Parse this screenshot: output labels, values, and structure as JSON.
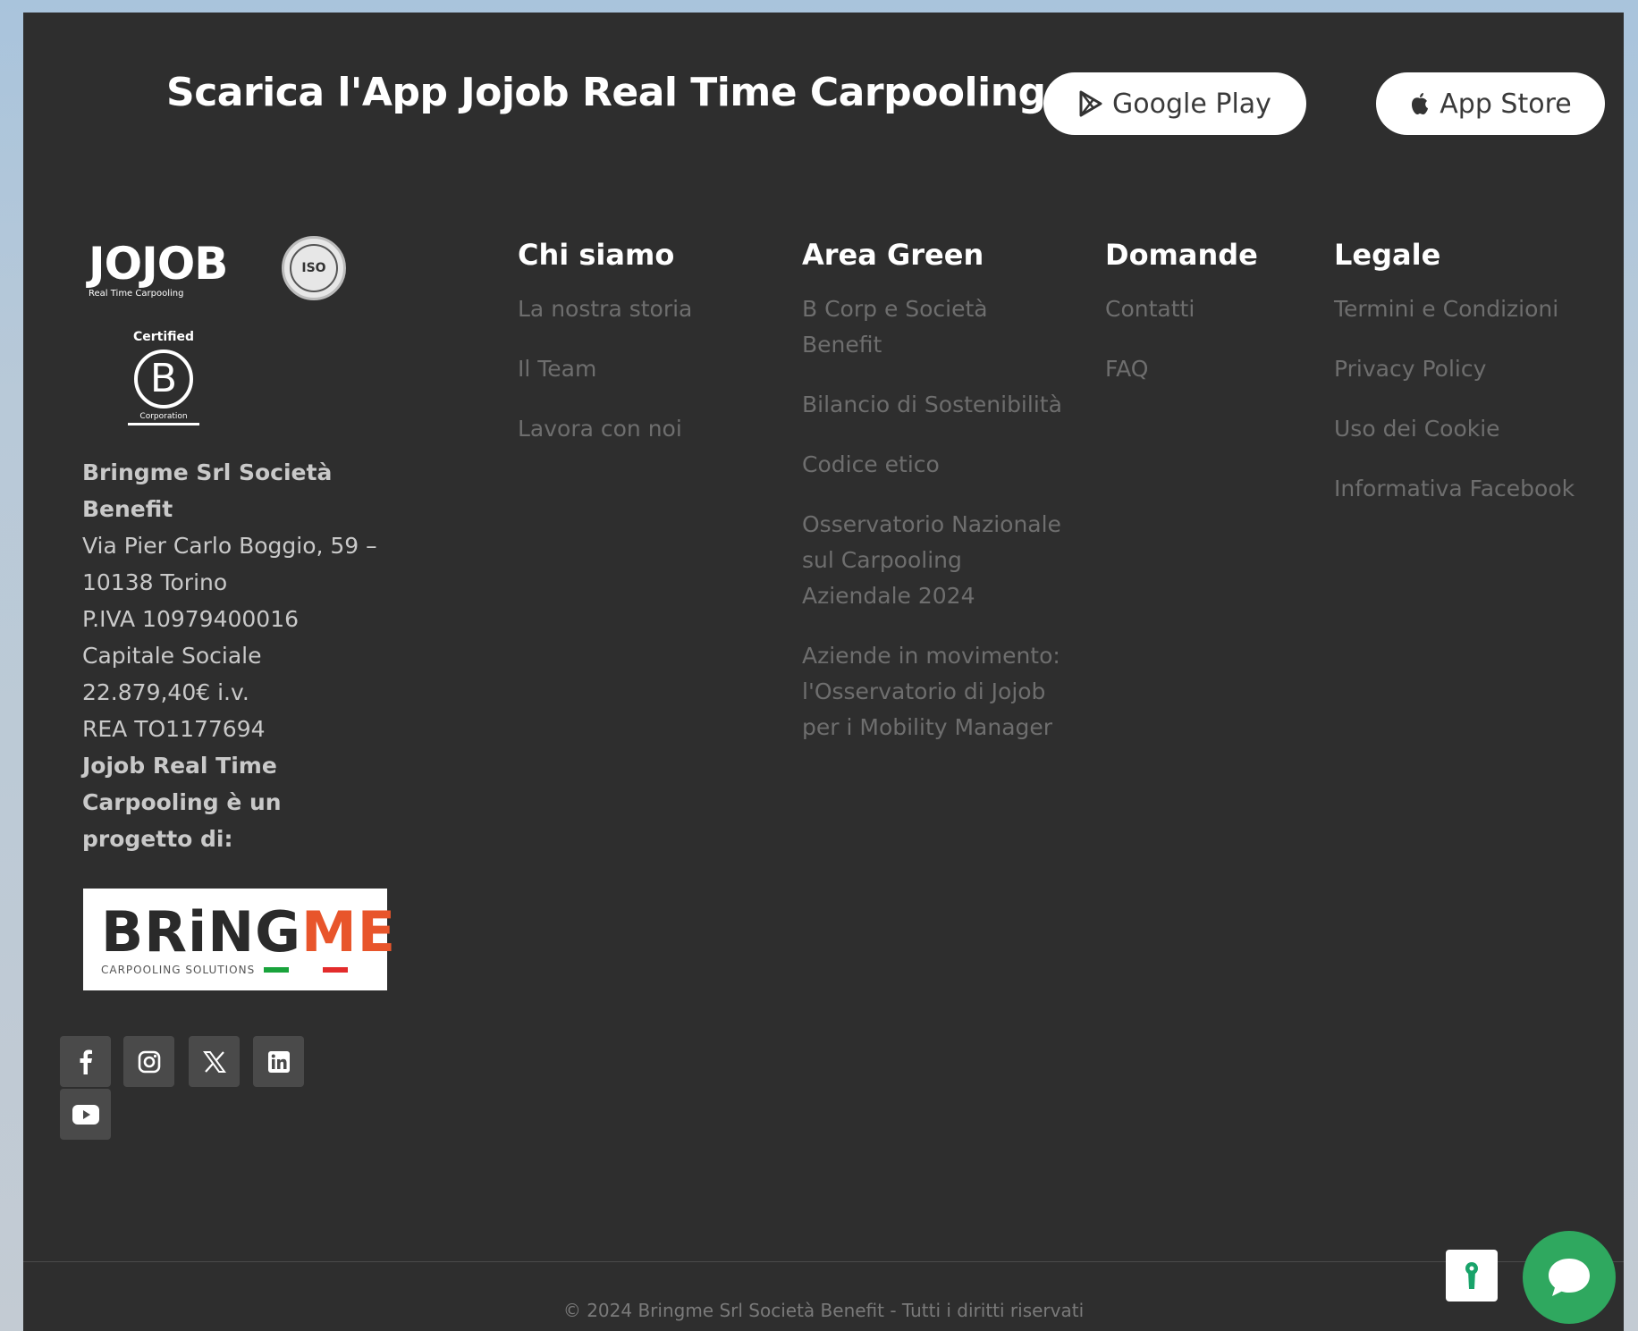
{
  "app_banner": {
    "title": "Scarica l'App Jojob Real Time Carpooling:",
    "google_play_label": "Google Play",
    "app_store_label": "App Store"
  },
  "logos": {
    "jojob_word": "JOJOB",
    "jojob_tagline": "Real Time Carpooling",
    "iso_text": "ISO",
    "bcorp_certified": "Certified",
    "bcorp_letter": "B",
    "bcorp_corporation": "Corporation",
    "bringme_word_a": "BRiNG",
    "bringme_word_b": "ME",
    "bringme_tagline": "CARPOOLING SOLUTIONS"
  },
  "company": {
    "name": "Bringme Srl Società Benefit",
    "address": "Via Pier Carlo Boggio, 59 – 10138 Torino",
    "vat": "P.IVA 10979400016",
    "capital": "Capitale Sociale 22.879,40€ i.v.",
    "rea": "REA TO1177694",
    "project_note": "Jojob Real Time Carpooling è un progetto di:"
  },
  "social": [
    "facebook-icon",
    "instagram-icon",
    "x-icon",
    "linkedin-icon",
    "youtube-icon"
  ],
  "columns": [
    {
      "title": "Chi siamo",
      "links": [
        "La nostra storia",
        "Il Team",
        "Lavora con noi"
      ]
    },
    {
      "title": "Area Green",
      "links": [
        "B Corp e Società Benefit",
        "Bilancio di Sostenibilità",
        "Codice etico",
        "Osservatorio Nazionale sul Carpooling Aziendale 2024",
        "Aziende in movimento: l'Osservatorio di Jojob per i Mobility Manager"
      ]
    },
    {
      "title": "Domande",
      "links": [
        "Contatti",
        "FAQ"
      ]
    },
    {
      "title": "Legale",
      "links": [
        "Termini e Condizioni",
        "Privacy Policy",
        "Uso dei Cookie",
        "Informativa Facebook"
      ]
    }
  ],
  "copyright": "© 2024 Bringme Srl Società Benefit - Tutti i diritti riservati",
  "colors": {
    "background": "#2e2e2e",
    "chat_button": "#2fa85f",
    "link": "#6e6e6e"
  }
}
